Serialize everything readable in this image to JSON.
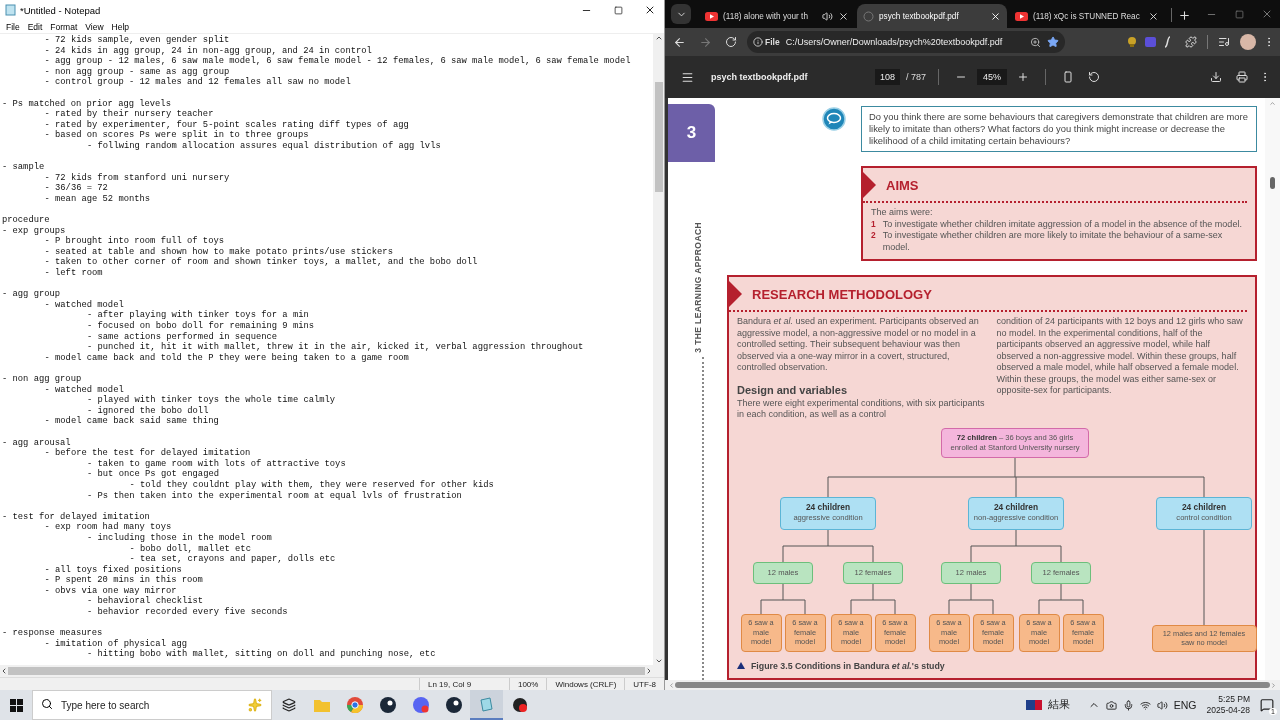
{
  "notepad": {
    "title": "*Untitled - Notepad",
    "menu": [
      "File",
      "Edit",
      "Format",
      "View",
      "Help"
    ],
    "sections": [
      [
        {
          "children": [
            {
              "text": "- 72 kids sample, even gender split"
            },
            {
              "text": "- 24 kids in agg group, 24 in non-agg group, and 24 in control"
            },
            {
              "text": "- agg group - 12 males, 6 saw male model, 6 saw female model - 12 females, 6 saw male model, 6 saw female model"
            },
            {
              "text": "- non agg group - same as agg group"
            },
            {
              "text": "- control group - 12 males and 12 females all saw no model"
            }
          ]
        }
      ],
      [
        {
          "text": "- Ps matched on prior agg levels",
          "children": [
            {
              "text": "- rated by their nursery teacher"
            },
            {
              "text": "- rated by experimenter, four 5-point scales rating diff types of agg"
            },
            {
              "text": "- based on scores Ps were split in to three groups",
              "children": [
                {
                  "text": "- follwing random allocation assures equal distribution of agg lvls"
                }
              ]
            }
          ]
        }
      ],
      [
        {
          "text": "- sample",
          "children": [
            {
              "text": "- 72 kids from stanford uni nursery"
            },
            {
              "text": "- 36/36 = 72"
            },
            {
              "text": "- mean age 52 months"
            }
          ]
        }
      ],
      [
        {
          "text": "procedure"
        },
        {
          "text": "- exp groups",
          "children": [
            {
              "text": "- P brought into room full of toys"
            },
            {
              "text": "- seated at table and shown how to make potato prints/use stickers"
            },
            {
              "text": "- taken to other corner of room and shown tinker toys, a mallet, and the bobo doll"
            },
            {
              "text": "- left room"
            }
          ]
        }
      ],
      [
        {
          "text": "- agg group",
          "children": [
            {
              "text": "- watched model",
              "children": [
                {
                  "text": "- after playing with tinker toys for a min"
                },
                {
                  "text": "- focused on bobo doll for remaining 9 mins"
                },
                {
                  "text": "- same actions performed in sequence"
                },
                {
                  "text": "- punched it, hit it with mallet, threw it in the air, kicked it, verbal aggression throughout"
                }
              ]
            },
            {
              "text": "- model came back and told the P they were being taken to a game room"
            }
          ]
        }
      ],
      [
        {
          "text": "- non agg group",
          "children": [
            {
              "text": "- watched model",
              "children": [
                {
                  "text": "- played with tinker toys the whole time calmly"
                },
                {
                  "text": "- ignored the bobo doll"
                }
              ]
            },
            {
              "text": "- model came back said same thing"
            }
          ]
        }
      ],
      [
        {
          "text": "- agg arousal",
          "children": [
            {
              "text": "- before the test for delayed imitation",
              "children": [
                {
                  "text": "- taken to game room with lots of attractive toys"
                },
                {
                  "text": "- but once Ps got engaged",
                  "children": [
                    {
                      "text": "- told they couldnt play with them, they were reserved for other kids"
                    }
                  ]
                },
                {
                  "text": "- Ps then taken into the experimental room at equal lvls of frustration"
                }
              ]
            }
          ]
        }
      ],
      [
        {
          "text": "- test for delayed imitation",
          "children": [
            {
              "text": "- exp room had many toys",
              "children": [
                {
                  "text": "- including those in the model room",
                  "children": [
                    {
                      "text": "- bobo doll, mallet etc"
                    },
                    {
                      "text": "- tea set, crayons and paper, dolls etc"
                    }
                  ]
                }
              ]
            },
            {
              "text": "- all toys fixed positions"
            },
            {
              "text": "- P spent 20 mins in this room"
            },
            {
              "text": "- obvs via one way mirror",
              "children": [
                {
                  "text": "- behavioral checklist"
                },
                {
                  "text": "- behavior recorded every five seconds"
                }
              ]
            }
          ]
        }
      ],
      [
        {
          "text": "- response measures",
          "children": [
            {
              "text": "- imitation of physical agg",
              "children": [
                {
                  "text": "- hitting bobo with mallet, sitting on doll and punching nose, etc"
                }
              ]
            }
          ]
        }
      ]
    ],
    "status": [
      "Ln 19, Col 9",
      "100%",
      "Windows (CRLF)",
      "UTF-8"
    ]
  },
  "browser": {
    "tabs": [
      {
        "title": "(118) alone with your th",
        "selected": false,
        "audio": true
      },
      {
        "title": "psych textbookpdf.pdf",
        "selected": true,
        "audio": false
      },
      {
        "title": "(118) xQc is STUNNED Reac",
        "selected": false,
        "audio": false
      }
    ],
    "address": {
      "scheme": "File",
      "url": "C:/Users/Owner/Downloads/psych%20textbookpdf.pdf",
      "bookmarked": true
    },
    "pdf_toolbar": {
      "title": "psych textbookpdf.pdf",
      "page": "108",
      "page_count": "/ 787",
      "zoom": "45%"
    },
    "page": {
      "chapter": "3",
      "running_head": "3 THE LEARNING APPROACH",
      "question": "Do you think there are some behaviours that caregivers demonstrate that children are more likely to imitate than others? What factors do you think might increase or decrease the likelihood of a child imitating certain behaviours?",
      "aims": {
        "heading": "AIMS",
        "intro": "The aims were:",
        "items": [
          {
            "number": "1",
            "text": "To investigate whether children imitate aggression of a model in the absence of the model."
          },
          {
            "number": "2",
            "text": "To investigate whether children are more likely to imitate the behaviour of a same-sex model."
          }
        ]
      },
      "methodology": {
        "heading": "RESEARCH METHODOLOGY",
        "paragraph_1": "Bandura *et al.* used an experiment. Participants observed an aggressive model, a non-aggressive model or no model in a controlled setting. Their subsequent behaviour was then observed via a one-way mirror in a covert, structured, controlled observation.",
        "subheading": "Design and variables",
        "paragraph_2": "There were eight experimental conditions, with six participants in each condition, as well as a control",
        "paragraph_3": "condition of 24 participants with 12 boys and 12 girls who saw no model. In the experimental conditions, half of the participants observed an aggressive model, while half observed a non-aggressive model. Within these groups, half observed a male model, while half observed a female model. Within these groups, the model was either same-sex or opposite-sex for participants.",
        "figure": {
          "root": {
            "kind": "sample",
            "title": "72 children",
            "text": "– 36 boys and 36 girls enrolled at Stanford University nursery",
            "children": [
              {
                "kind": "condition",
                "title": "24 children",
                "text": "aggressive condition",
                "children": [
                  {
                    "kind": "sex",
                    "text": "12 males",
                    "children": [
                      {
                        "kind": "outcome",
                        "text": "6 saw a male model"
                      },
                      {
                        "kind": "outcome",
                        "text": "6 saw a female model"
                      }
                    ]
                  },
                  {
                    "kind": "sex",
                    "text": "12 females",
                    "children": [
                      {
                        "kind": "outcome",
                        "text": "6 saw a male model"
                      },
                      {
                        "kind": "outcome",
                        "text": "6 saw a female model"
                      }
                    ]
                  }
                ]
              },
              {
                "kind": "condition",
                "title": "24 children",
                "text": "non-aggressive condition",
                "children": [
                  {
                    "kind": "sex",
                    "text": "12 males",
                    "children": [
                      {
                        "kind": "outcome",
                        "text": "6 saw a male model"
                      },
                      {
                        "kind": "outcome",
                        "text": "6 saw a female model"
                      }
                    ]
                  },
                  {
                    "kind": "sex",
                    "text": "12 females",
                    "children": [
                      {
                        "kind": "outcome",
                        "text": "6 saw a male model"
                      },
                      {
                        "kind": "outcome",
                        "text": "6 saw a female model"
                      }
                    ]
                  }
                ]
              },
              {
                "kind": "condition",
                "title": "24 children",
                "text": "control condition",
                "children": [
                  {
                    "kind": "outcome",
                    "text": "12 males and 12 females saw no model"
                  }
                ]
              }
            ]
          },
          "caption": "Figure 3.5 Conditions in Bandura *et al.*'s study"
        }
      }
    }
  },
  "taskbar": {
    "search": {
      "placeholder": "Type here to search"
    },
    "weather": "結果",
    "language": "ENG",
    "time": "5:25 PM",
    "date": "2025-04-28",
    "notifications": "1"
  }
}
